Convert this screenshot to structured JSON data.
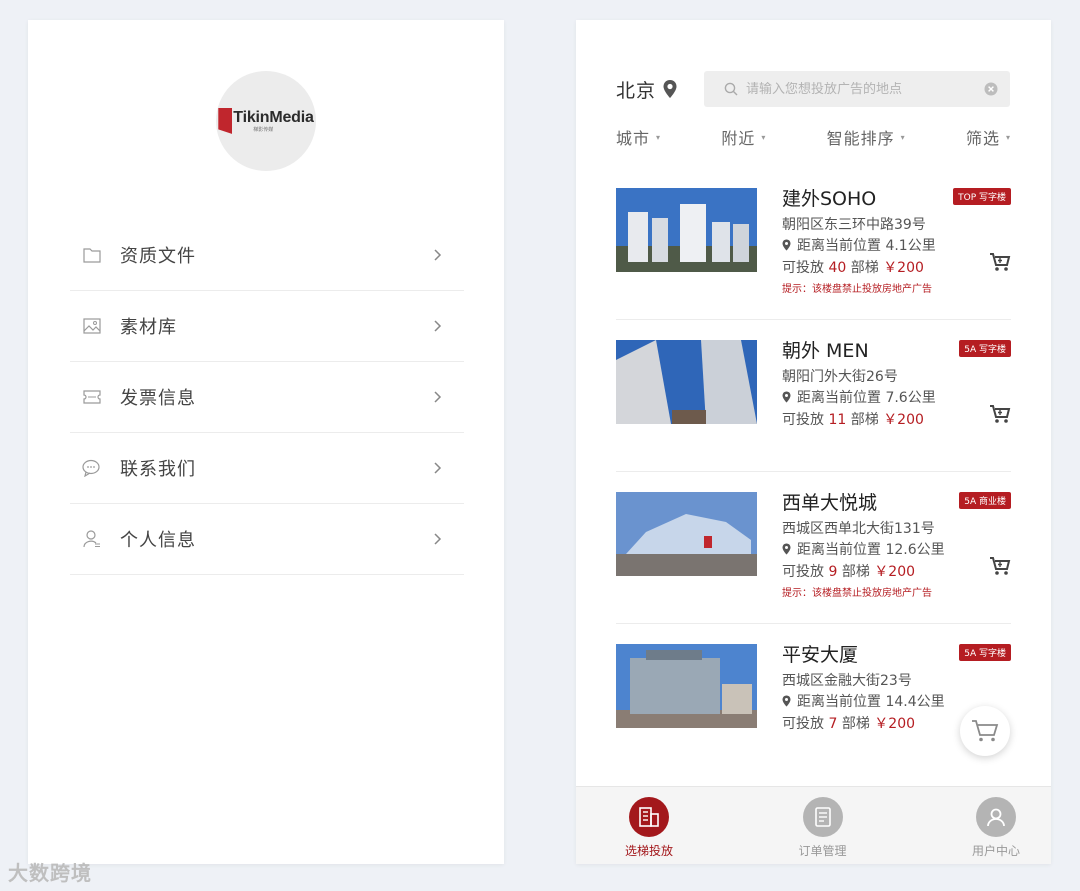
{
  "profile_screen": {
    "logo": {
      "brand": "TikinMedia",
      "subtitle": "梯影传媒"
    },
    "menu": [
      {
        "label": "资质文件",
        "icon": "folder-icon"
      },
      {
        "label": "素材库",
        "icon": "image-icon"
      },
      {
        "label": "发票信息",
        "icon": "invoice-icon"
      },
      {
        "label": "联系我们",
        "icon": "chat-icon"
      },
      {
        "label": "个人信息",
        "icon": "user-icon"
      }
    ]
  },
  "listing_screen": {
    "city": "北京",
    "search": {
      "placeholder": "请输入您想投放广告的地点",
      "value": ""
    },
    "filters": [
      "城市",
      "附近",
      "智能排序",
      "筛选"
    ],
    "listings": [
      {
        "title": "建外SOHO",
        "tag": "TOP 写字楼",
        "address": "朝阳区东三环中路39号",
        "distance": "距离当前位置 4.1公里",
        "avail_prefix": "可投放",
        "elevators": "40",
        "avail_unit": "部梯",
        "price": "￥200",
        "warning": "提示：该楼盘禁止投放房地产广告"
      },
      {
        "title": "朝外 MEN",
        "tag": "5A 写字楼",
        "address": "朝阳门外大街26号",
        "distance": "距离当前位置 7.6公里",
        "avail_prefix": "可投放",
        "elevators": "11",
        "avail_unit": "部梯",
        "price": "￥200",
        "warning": ""
      },
      {
        "title": "西单大悦城",
        "tag": "5A 商业楼",
        "address": "西城区西单北大街131号",
        "distance": "距离当前位置 12.6公里",
        "avail_prefix": "可投放",
        "elevators": "9",
        "avail_unit": "部梯",
        "price": "￥200",
        "warning": "提示：该楼盘禁止投放房地产广告"
      },
      {
        "title": "平安大厦",
        "tag": "5A 写字楼",
        "address": "西城区金融大街23号",
        "distance": "距离当前位置 14.4公里",
        "avail_prefix": "可投放",
        "elevators": "7",
        "avail_unit": "部梯",
        "price": "￥200",
        "warning": ""
      }
    ],
    "tabs": [
      {
        "label": "选梯投放",
        "icon": "building-icon",
        "active": true
      },
      {
        "label": "订单管理",
        "icon": "document-icon",
        "active": false
      },
      {
        "label": "用户中心",
        "icon": "user-icon",
        "active": false
      }
    ]
  },
  "watermark": "大数跨境",
  "colors": {
    "accent": "#b51d22",
    "tab_active": "#a3181c",
    "background": "#eef1f6"
  }
}
